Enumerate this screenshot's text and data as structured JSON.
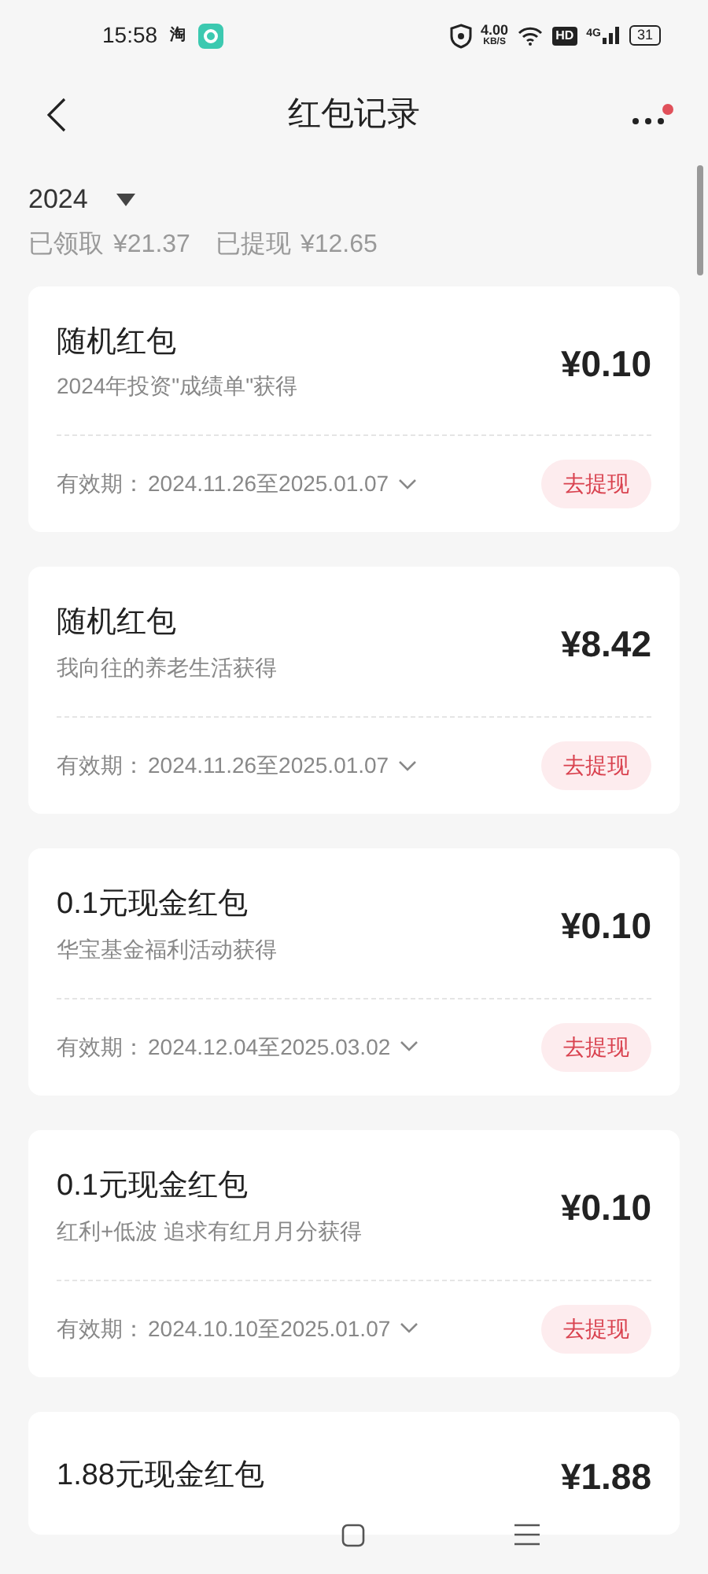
{
  "status_bar": {
    "time": "15:58",
    "app_badge": "淘",
    "speed": "4.00",
    "speed_unit": "KB/S",
    "hd": "HD",
    "network": "4G",
    "battery": "31"
  },
  "header": {
    "title": "红包记录",
    "has_notification": true
  },
  "filter": {
    "year": "2024"
  },
  "summary": {
    "received_label": "已领取",
    "received": "¥21.37",
    "withdrawn_label": "已提现",
    "withdrawn": "¥12.65"
  },
  "records": [
    {
      "title": "随机红包",
      "source": "2024年投资\"成绩单\"获得",
      "amount": "¥0.10",
      "validity_label": "有效期：",
      "validity": "2024.11.26至2025.01.07",
      "action": "去提现"
    },
    {
      "title": "随机红包",
      "source": "我向往的养老生活获得",
      "amount": "¥8.42",
      "validity_label": "有效期：",
      "validity": "2024.11.26至2025.01.07",
      "action": "去提现"
    },
    {
      "title": "0.1元现金红包",
      "source": "华宝基金福利活动获得",
      "amount": "¥0.10",
      "validity_label": "有效期：",
      "validity": "2024.12.04至2025.03.02",
      "action": "去提现"
    },
    {
      "title": "0.1元现金红包",
      "source": "红利+低波 追求有红月月分获得",
      "amount": "¥0.10",
      "validity_label": "有效期：",
      "validity": "2024.10.10至2025.01.07",
      "action": "去提现"
    },
    {
      "title": "1.88元现金红包",
      "amount": "¥1.88"
    }
  ]
}
